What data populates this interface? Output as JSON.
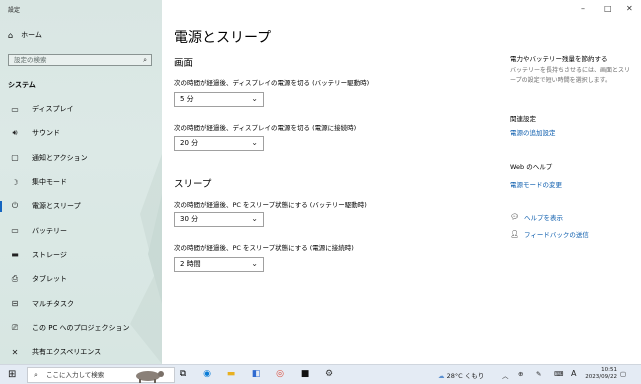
{
  "window": {
    "title": "設定",
    "min": "–",
    "max": "□",
    "close": "✕"
  },
  "sidebar": {
    "home_label": "ホーム",
    "search_placeholder": "設定の検索",
    "section_label": "システム",
    "items": [
      {
        "label": "ディスプレイ",
        "icon": "display-icon"
      },
      {
        "label": "サウンド",
        "icon": "sound-icon"
      },
      {
        "label": "通知とアクション",
        "icon": "notification-icon"
      },
      {
        "label": "集中モード",
        "icon": "focus-moon-icon"
      },
      {
        "label": "電源とスリープ",
        "icon": "power-icon"
      },
      {
        "label": "バッテリー",
        "icon": "battery-icon"
      },
      {
        "label": "ストレージ",
        "icon": "storage-icon"
      },
      {
        "label": "タブレット",
        "icon": "tablet-icon"
      },
      {
        "label": "マルチタスク",
        "icon": "multitask-icon"
      },
      {
        "label": "この PC へのプロジェクション",
        "icon": "projection-icon"
      },
      {
        "label": "共有エクスペリエンス",
        "icon": "shared-experience-icon"
      }
    ],
    "active_index": 4
  },
  "main": {
    "title": "電源とスリープ",
    "screen": {
      "heading": "画面",
      "battery_label": "次の時間が経過後、ディスプレイの電源を切る (バッテリー駆動時)",
      "battery_value": "5 分",
      "plugged_label": "次の時間が経過後、ディスプレイの電源を切る (電源に接続時)",
      "plugged_value": "20 分"
    },
    "sleep": {
      "heading": "スリープ",
      "battery_label": "次の時間が経過後、PC をスリープ状態にする (バッテリー駆動時)",
      "battery_value": "30 分",
      "plugged_label": "次の時間が経過後、PC をスリープ状態にする (電源に接続時)",
      "plugged_value": "2 時間"
    }
  },
  "right_panel": {
    "save_heading": "電力やバッテリー残量を節約する",
    "save_text": "バッテリーを長持ちさせるには、画面とスリープの設定で短い時間を選択します。",
    "related_heading": "関連設定",
    "related_link": "電源の追加設定",
    "web_help_heading": "Web のヘルプ",
    "web_help_link": "電源モードの変更",
    "get_help": "ヘルプを表示",
    "feedback": "フィードバックの送信"
  },
  "taskbar": {
    "search_placeholder": "ここに入力して検索",
    "weather": "28°C くもり",
    "ime": "A",
    "time": "10:51",
    "date": "2023/09/22"
  },
  "colors": {
    "accent": "#1565c0",
    "link": "#0b5cad",
    "sidebar_bg": "#d9e6e3"
  }
}
